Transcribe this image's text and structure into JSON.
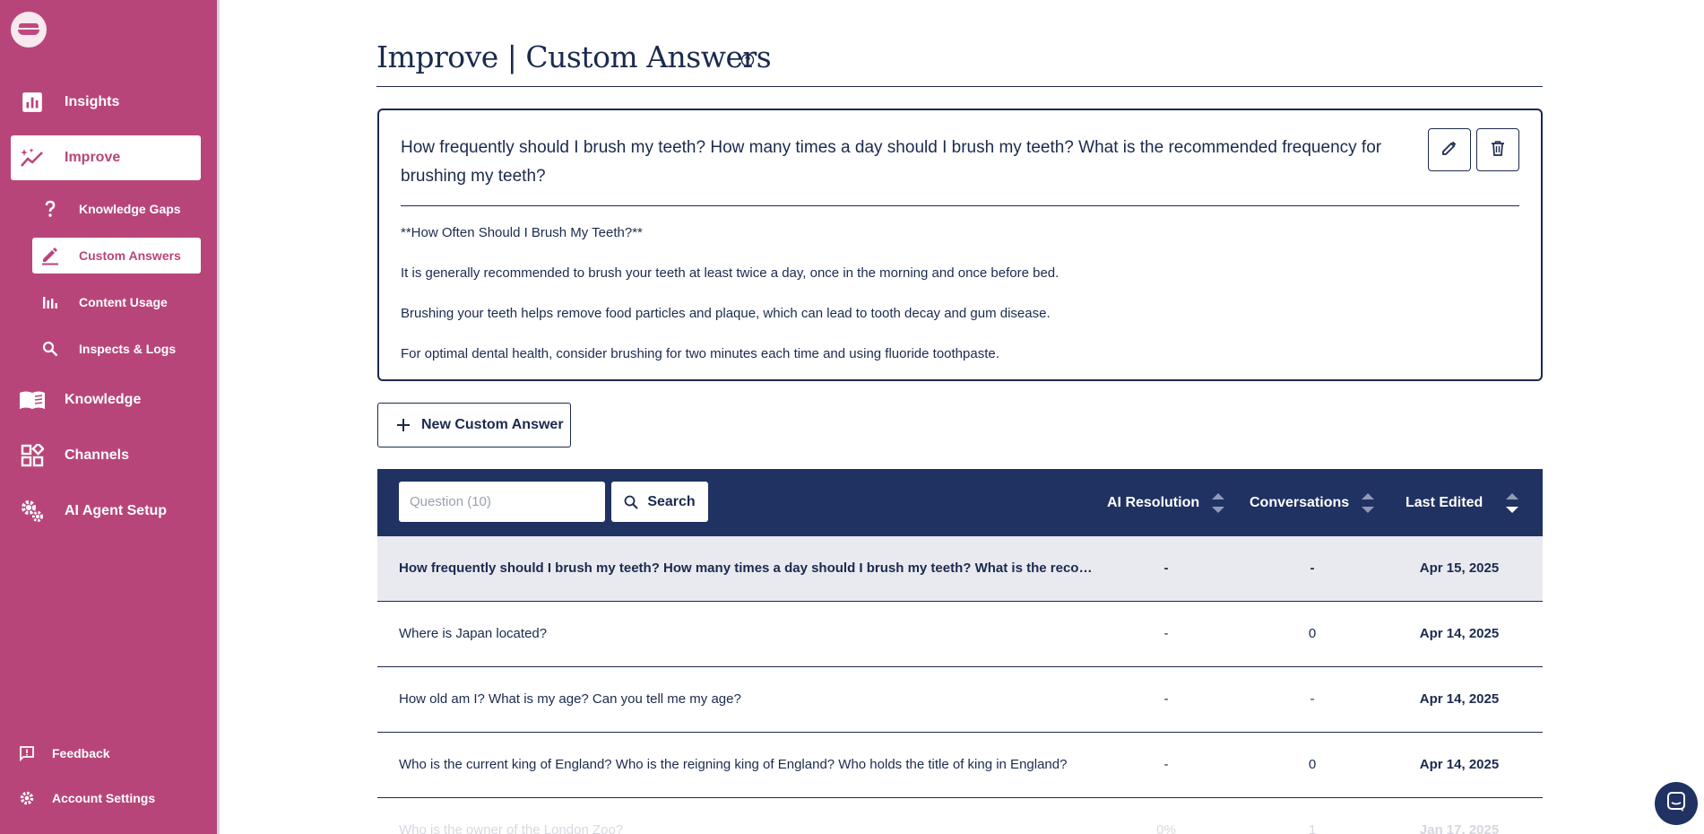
{
  "colors": {
    "sidebar": "#b8457a",
    "navy": "#1f3261",
    "text": "#1b2a4e",
    "selected_row": "#e8eaef"
  },
  "sidebar": {
    "nav": [
      {
        "label": "Insights",
        "icon": "bar-chart-icon"
      },
      {
        "label": "Improve",
        "icon": "sparkle-trend-icon",
        "active": true
      },
      {
        "label": "Knowledge",
        "icon": "open-book-icon"
      },
      {
        "label": "Channels",
        "icon": "widgets-icon"
      },
      {
        "label": "AI Agent Setup",
        "icon": "gears-icon"
      }
    ],
    "sub": [
      {
        "label": "Knowledge Gaps",
        "icon": "question-mark-icon"
      },
      {
        "label": "Custom Answers",
        "icon": "pencil-icon",
        "active": true
      },
      {
        "label": "Content Usage",
        "icon": "bars-icon"
      },
      {
        "label": "Inspects & Logs",
        "icon": "magnifier-icon"
      }
    ],
    "footer": [
      {
        "label": "Feedback",
        "icon": "feedback-icon"
      },
      {
        "label": "Account Settings",
        "icon": "gear-icon"
      }
    ]
  },
  "page": {
    "title": "Improve | Custom Answers"
  },
  "detail": {
    "question": "How frequently should I brush my teeth? How many times a day should I brush my teeth? What is the recommended frequency for brushing my teeth?",
    "paragraphs": [
      "**How Often Should I Brush My Teeth?**",
      "It is generally recommended to brush your teeth at least twice a day, once in the morning and once before bed.",
      "Brushing your teeth helps remove food particles and plaque, which can lead to tooth decay and gum disease.",
      "For optimal dental health, consider brushing for two minutes each time and using fluoride toothpaste."
    ]
  },
  "actions": {
    "new_label": "New Custom Answer"
  },
  "table": {
    "search_placeholder": "Question (10)",
    "search_label": "Search",
    "columns": [
      "AI Resolution",
      "Conversations",
      "Last Edited"
    ],
    "sorted_column": "Last Edited",
    "sort_direction": "desc",
    "rows": [
      {
        "question": "How frequently should I brush my teeth? How many times a day should I brush my teeth? What is the reco…",
        "ai_resolution": "-",
        "conversations": "-",
        "last_edited": "Apr 15, 2025",
        "selected": true
      },
      {
        "question": "Where is Japan located?",
        "ai_resolution": "-",
        "conversations": "0",
        "last_edited": "Apr 14, 2025"
      },
      {
        "question": "How old am I? What is my age? Can you tell me my age?",
        "ai_resolution": "-",
        "conversations": "-",
        "last_edited": "Apr 14, 2025"
      },
      {
        "question": "Who is the current king of England? Who is the reigning king of England? Who holds the title of king in England?",
        "ai_resolution": "-",
        "conversations": "0",
        "last_edited": "Apr 14, 2025"
      },
      {
        "question": "Who is the owner of the London Zoo?",
        "ai_resolution": "0%",
        "conversations": "1",
        "last_edited": "Jan 17, 2025"
      }
    ]
  }
}
